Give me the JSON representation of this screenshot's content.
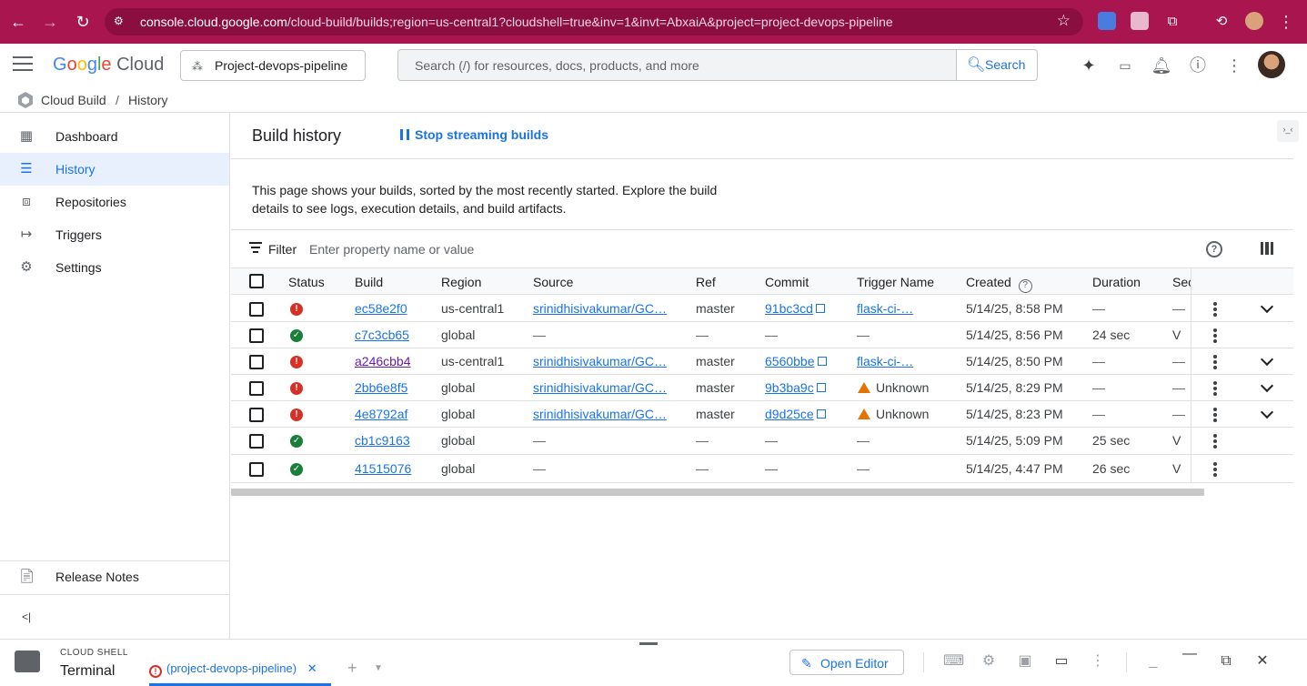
{
  "browser": {
    "url_host": "console.cloud.google.com",
    "url_path": "/cloud-build/builds;region=us-central1?cloudshell=true&inv=1&invt=AbxaiA&project=project-devops-pipeline"
  },
  "header": {
    "logo_google": [
      "G",
      "o",
      "o",
      "g",
      "l",
      "e"
    ],
    "logo_cloud": "Cloud",
    "project": "Project-devops-pipeline",
    "search_placeholder": "Search (/) for resources, docs, products, and more",
    "search_button": "Search"
  },
  "breadcrumb": {
    "service": "Cloud Build",
    "separator": "/",
    "page": "History"
  },
  "sidebar": {
    "items": [
      {
        "label": "Dashboard",
        "icon": "dashboard-icon"
      },
      {
        "label": "History",
        "icon": "list-icon",
        "active": true
      },
      {
        "label": "Repositories",
        "icon": "repository-icon"
      },
      {
        "label": "Triggers",
        "icon": "trigger-icon"
      },
      {
        "label": "Settings",
        "icon": "gear-icon"
      }
    ],
    "release_notes": "Release Notes",
    "collapse": "<|"
  },
  "main": {
    "title": "Build history",
    "stop_button": "Stop streaming builds",
    "description": "This page shows your builds, sorted by the most recently started. Explore the build details to see logs, execution details, and build artifacts.",
    "filter_label": "Filter",
    "filter_placeholder": "Enter property name or value"
  },
  "table": {
    "columns": [
      "Status",
      "Build",
      "Region",
      "Source",
      "Ref",
      "Commit",
      "Trigger Name",
      "Created",
      "Duration",
      "Sec"
    ],
    "rows": [
      {
        "status": "error",
        "build": "ec58e2f0",
        "region": "us-central1",
        "source": "srinidhisivakumar/GC…",
        "ref": "master",
        "commit": "91bc3cd",
        "trigger": "flask-ci-…",
        "trigger_type": "link",
        "created": "5/14/25, 8:58 PM",
        "duration": "—",
        "sec": "—",
        "expand": true
      },
      {
        "status": "success",
        "build": "c7c3cb65",
        "region": "global",
        "source": "—",
        "ref": "—",
        "commit": "—",
        "trigger": "—",
        "trigger_type": "dash",
        "created": "5/14/25, 8:56 PM",
        "duration": "24 sec",
        "sec": "V",
        "expand": false
      },
      {
        "status": "error",
        "build": "a246cbb4",
        "region": "us-central1",
        "source": "srinidhisivakumar/GC…",
        "ref": "master",
        "commit": "6560bbe",
        "trigger": "flask-ci-…",
        "trigger_type": "link",
        "created": "5/14/25, 8:50 PM",
        "duration": "—",
        "sec": "—",
        "expand": true,
        "visited": true
      },
      {
        "status": "error",
        "build": "2bb6e8f5",
        "region": "global",
        "source": "srinidhisivakumar/GC…",
        "ref": "master",
        "commit": "9b3ba9c",
        "trigger": "Unknown",
        "trigger_type": "warn",
        "created": "5/14/25, 8:29 PM",
        "duration": "—",
        "sec": "—",
        "expand": true
      },
      {
        "status": "error",
        "build": "4e8792af",
        "region": "global",
        "source": "srinidhisivakumar/GC…",
        "ref": "master",
        "commit": "d9d25ce",
        "trigger": "Unknown",
        "trigger_type": "warn",
        "created": "5/14/25, 8:23 PM",
        "duration": "—",
        "sec": "—",
        "expand": true
      },
      {
        "status": "success",
        "build": "cb1c9163",
        "region": "global",
        "source": "—",
        "ref": "—",
        "commit": "—",
        "trigger": "—",
        "trigger_type": "dash",
        "created": "5/14/25, 5:09 PM",
        "duration": "25 sec",
        "sec": "V",
        "expand": false
      },
      {
        "status": "success",
        "build": "41515076",
        "region": "global",
        "source": "—",
        "ref": "—",
        "commit": "—",
        "trigger": "—",
        "trigger_type": "dash",
        "created": "5/14/25, 4:47 PM",
        "duration": "26 sec",
        "sec": "V",
        "expand": false
      }
    ]
  },
  "shell": {
    "label": "CLOUD SHELL",
    "title": "Terminal",
    "tab": "(project-devops-pipeline)",
    "open_editor": "Open Editor"
  },
  "colors": {
    "chrome": "#a8154f",
    "accent": "#1a73e8",
    "error": "#d93025",
    "success": "#188038",
    "warning": "#e37400"
  }
}
